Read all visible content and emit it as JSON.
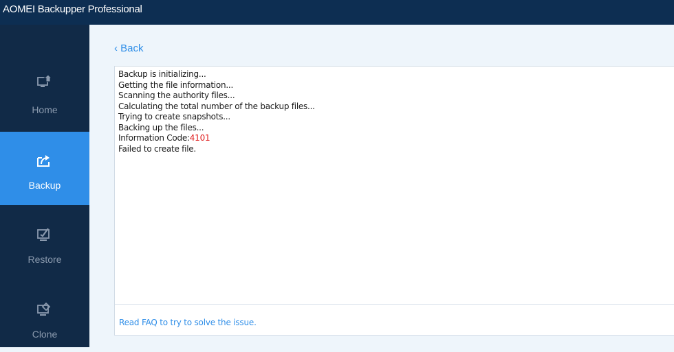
{
  "window": {
    "title": "AOMEI Backupper Professional"
  },
  "sidebar": {
    "items": [
      {
        "label": "Home",
        "icon": "home-monitor-icon",
        "active": false
      },
      {
        "label": "Backup",
        "icon": "backup-export-icon",
        "active": true
      },
      {
        "label": "Restore",
        "icon": "restore-icon",
        "active": false
      },
      {
        "label": "Clone",
        "icon": "clone-icon",
        "active": false
      }
    ]
  },
  "main": {
    "back_label": "‹ Back",
    "log": {
      "lines": [
        "Backup is initializing...",
        "Getting the file information...",
        "Scanning the authority files...",
        "Calculating the total number of the backup files...",
        "Trying to create snapshots...",
        "Backing up the files..."
      ],
      "info_code_label": "Information Code:",
      "info_code_value": "4101",
      "final_line": "Failed to create file."
    },
    "faq_link": "Read FAQ to try to solve the issue."
  },
  "colors": {
    "titlebar": "#0d2e52",
    "sidebar": "#112a47",
    "accent": "#2f8ee8",
    "error_code": "#e02020"
  }
}
